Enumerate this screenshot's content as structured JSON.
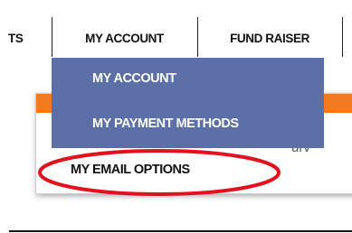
{
  "nav": {
    "items": [
      {
        "label": "TS"
      },
      {
        "label": "MY ACCOUNT"
      },
      {
        "label": "FUND RAISER"
      }
    ]
  },
  "dropdown": {
    "items": [
      {
        "label": "MY ACCOUNT"
      },
      {
        "label": "MY PAYMENT METHODS"
      },
      {
        "label": "MY EMAIL OPTIONS"
      }
    ]
  },
  "content": {
    "partial_text": "ed;\nurv"
  },
  "colors": {
    "dropdown_bg": "#5c6fa6",
    "accent_orange": "#ef7a22",
    "highlight_red": "#e3101e"
  }
}
